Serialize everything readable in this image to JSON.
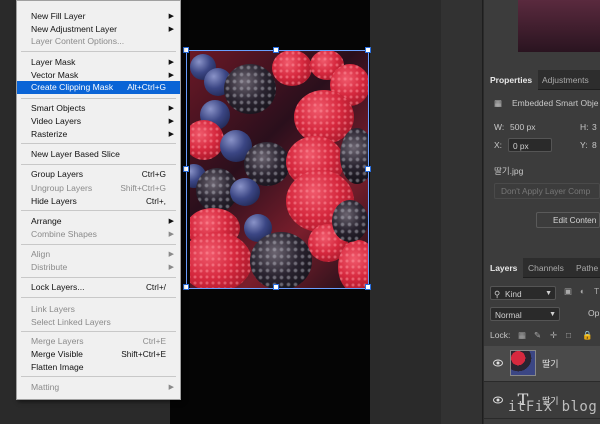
{
  "context_menu": {
    "items": [
      {
        "label": "New Fill Layer",
        "shortcut": "",
        "submenu": true,
        "disabled": false,
        "highlight": false
      },
      {
        "label": "New Adjustment Layer",
        "shortcut": "",
        "submenu": true,
        "disabled": false,
        "highlight": false
      },
      {
        "label": "Layer Content Options...",
        "shortcut": "",
        "submenu": false,
        "disabled": true,
        "highlight": false
      },
      {
        "label": "Layer Mask",
        "shortcut": "",
        "submenu": true,
        "disabled": false,
        "highlight": false
      },
      {
        "label": "Vector Mask",
        "shortcut": "",
        "submenu": true,
        "disabled": false,
        "highlight": false
      },
      {
        "label": "Create Clipping Mask",
        "shortcut": "Alt+Ctrl+G",
        "submenu": false,
        "disabled": false,
        "highlight": true
      },
      {
        "label": "Smart Objects",
        "shortcut": "",
        "submenu": true,
        "disabled": false,
        "highlight": false
      },
      {
        "label": "Video Layers",
        "shortcut": "",
        "submenu": true,
        "disabled": false,
        "highlight": false
      },
      {
        "label": "Rasterize",
        "shortcut": "",
        "submenu": true,
        "disabled": false,
        "highlight": false
      },
      {
        "label": "New Layer Based Slice",
        "shortcut": "",
        "submenu": false,
        "disabled": false,
        "highlight": false
      },
      {
        "label": "Group Layers",
        "shortcut": "Ctrl+G",
        "submenu": false,
        "disabled": false,
        "highlight": false
      },
      {
        "label": "Ungroup Layers",
        "shortcut": "Shift+Ctrl+G",
        "submenu": false,
        "disabled": true,
        "highlight": false
      },
      {
        "label": "Hide Layers",
        "shortcut": "Ctrl+,",
        "submenu": false,
        "disabled": false,
        "highlight": false
      },
      {
        "label": "Arrange",
        "shortcut": "",
        "submenu": true,
        "disabled": false,
        "highlight": false
      },
      {
        "label": "Combine Shapes",
        "shortcut": "",
        "submenu": true,
        "disabled": true,
        "highlight": false
      },
      {
        "label": "Align",
        "shortcut": "",
        "submenu": true,
        "disabled": true,
        "highlight": false
      },
      {
        "label": "Distribute",
        "shortcut": "",
        "submenu": true,
        "disabled": true,
        "highlight": false
      },
      {
        "label": "Lock Layers...",
        "shortcut": "Ctrl+/",
        "submenu": false,
        "disabled": false,
        "highlight": false
      },
      {
        "label": "Link Layers",
        "shortcut": "",
        "submenu": false,
        "disabled": true,
        "highlight": false
      },
      {
        "label": "Select Linked Layers",
        "shortcut": "",
        "submenu": false,
        "disabled": true,
        "highlight": false
      },
      {
        "label": "Merge Layers",
        "shortcut": "Ctrl+E",
        "submenu": false,
        "disabled": true,
        "highlight": false
      },
      {
        "label": "Merge Visible",
        "shortcut": "Shift+Ctrl+E",
        "submenu": false,
        "disabled": false,
        "highlight": false
      },
      {
        "label": "Flatten Image",
        "shortcut": "",
        "submenu": false,
        "disabled": false,
        "highlight": false
      },
      {
        "label": "Matting",
        "shortcut": "",
        "submenu": true,
        "disabled": true,
        "highlight": false
      }
    ]
  },
  "properties_panel": {
    "tabs": [
      "Properties",
      "Adjustments"
    ],
    "object_type": "Embedded Smart Obje",
    "w_label": "W:",
    "w_value": "500 px",
    "h_label": "H:",
    "h_value": "3",
    "x_label": "X:",
    "x_value": "0 px",
    "y_label": "Y:",
    "y_value": "8",
    "file_name": "딸기.jpg",
    "dont_apply_btn": "Don't Apply Layer Comp",
    "edit_contents_btn": "Edit Conten"
  },
  "layers_panel": {
    "tabs": [
      "Layers",
      "Channels",
      "Pathe"
    ],
    "filter_kind": "Kind",
    "blend_mode": "Normal",
    "opacity_label": "Op",
    "lock_label": "Lock:",
    "layers": [
      {
        "name": "딸기",
        "type": "smart-object",
        "selected": true
      },
      {
        "name": "딸기",
        "type": "text",
        "selected": false
      }
    ]
  },
  "watermark": "itFix blog"
}
